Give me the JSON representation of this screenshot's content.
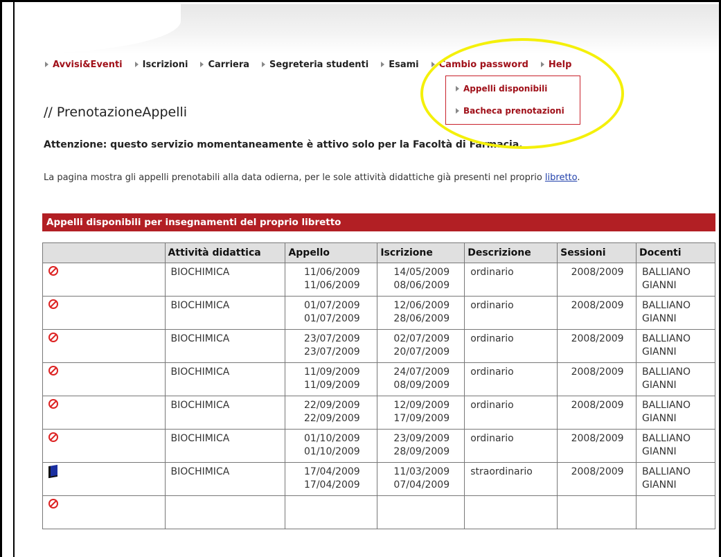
{
  "nav": {
    "items": [
      {
        "label": "Avvisi&Eventi",
        "color": "#a0111a"
      },
      {
        "label": "Iscrizioni",
        "color": "#222222"
      },
      {
        "label": "Carriera",
        "color": "#222222"
      },
      {
        "label": "Segreteria studenti",
        "color": "#222222"
      },
      {
        "label": "Esami",
        "color": "#222222"
      },
      {
        "label": "Cambio password",
        "color": "#a0111a"
      },
      {
        "label": "Help",
        "color": "#a0111a"
      }
    ],
    "dropdown": [
      "Appelli disponibili",
      "Bacheca prenotazioni"
    ]
  },
  "page": {
    "title": "// PrenotazioneAppelli",
    "warning": "Attenzione: questo servizio momentaneamente è attivo solo per la Facoltà di Farmacia.",
    "intro_text": "La pagina mostra gli appelli prenotabili alla data odierna, per le sole attività  didattiche già  presenti nel proprio ",
    "intro_link": "libretto",
    "intro_end": "."
  },
  "section": {
    "title": "Appelli disponibili per insegnamenti del proprio libretto"
  },
  "table": {
    "headers": [
      "",
      "Attività didattica",
      "Appello",
      "Iscrizione",
      "Descrizione",
      "Sessioni",
      "Docenti"
    ],
    "rows": [
      {
        "icon": "no-entry-icon",
        "attivita": "BIOCHIMICA",
        "appello1": "11/06/2009",
        "appello2": "11/06/2009",
        "iscr1": "14/05/2009",
        "iscr2": "08/06/2009",
        "descrizione": "ordinario",
        "sessioni": "2008/2009",
        "doc1": "BALLIANO",
        "doc2": "GIANNI"
      },
      {
        "icon": "no-entry-icon",
        "attivita": "BIOCHIMICA",
        "appello1": "01/07/2009",
        "appello2": "01/07/2009",
        "iscr1": "12/06/2009",
        "iscr2": "28/06/2009",
        "descrizione": "ordinario",
        "sessioni": "2008/2009",
        "doc1": "BALLIANO",
        "doc2": "GIANNI"
      },
      {
        "icon": "no-entry-icon",
        "attivita": "BIOCHIMICA",
        "appello1": "23/07/2009",
        "appello2": "23/07/2009",
        "iscr1": "02/07/2009",
        "iscr2": "20/07/2009",
        "descrizione": "ordinario",
        "sessioni": "2008/2009",
        "doc1": "BALLIANO",
        "doc2": "GIANNI"
      },
      {
        "icon": "no-entry-icon",
        "attivita": "BIOCHIMICA",
        "appello1": "11/09/2009",
        "appello2": "11/09/2009",
        "iscr1": "24/07/2009",
        "iscr2": "08/09/2009",
        "descrizione": "ordinario",
        "sessioni": "2008/2009",
        "doc1": "BALLIANO",
        "doc2": "GIANNI"
      },
      {
        "icon": "no-entry-icon",
        "attivita": "BIOCHIMICA",
        "appello1": "22/09/2009",
        "appello2": "22/09/2009",
        "iscr1": "12/09/2009",
        "iscr2": "17/09/2009",
        "descrizione": "ordinario",
        "sessioni": "2008/2009",
        "doc1": "BALLIANO",
        "doc2": "GIANNI"
      },
      {
        "icon": "no-entry-icon",
        "attivita": "BIOCHIMICA",
        "appello1": "01/10/2009",
        "appello2": "01/10/2009",
        "iscr1": "23/09/2009",
        "iscr2": "28/09/2009",
        "descrizione": "ordinario",
        "sessioni": "2008/2009",
        "doc1": "BALLIANO",
        "doc2": "GIANNI"
      },
      {
        "icon": "book-icon",
        "attivita": "BIOCHIMICA",
        "appello1": "17/04/2009",
        "appello2": "17/04/2009",
        "iscr1": "11/03/2009",
        "iscr2": "07/04/2009",
        "descrizione": "straordinario",
        "sessioni": "2008/2009",
        "doc1": "BALLIANO",
        "doc2": "GIANNI"
      }
    ]
  },
  "colors": {
    "accent": "#b21f24",
    "highlight": "#f4f00a",
    "link": "#1f3faa"
  }
}
